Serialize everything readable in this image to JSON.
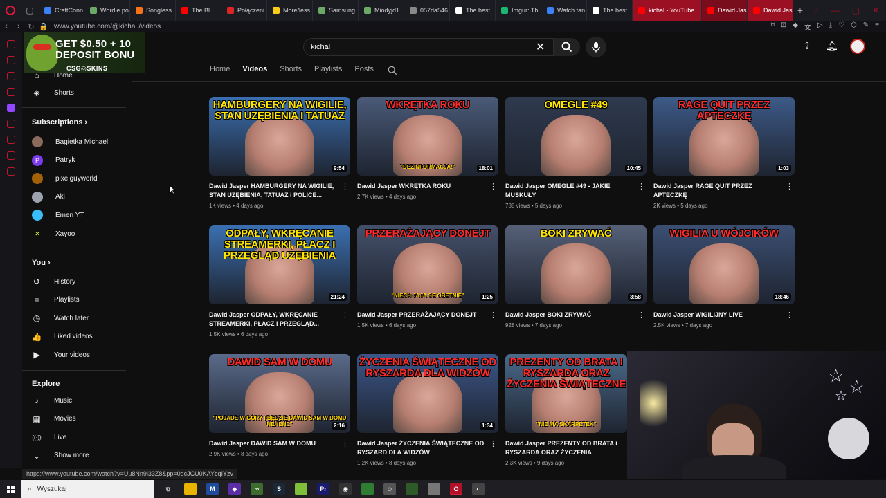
{
  "browser": {
    "tabs": [
      {
        "label": "CraftConn",
        "color": "#3b82f6"
      },
      {
        "label": "Wordle po",
        "color": "#6aaa64"
      },
      {
        "label": "Songless",
        "color": "#f97316"
      },
      {
        "label": "The Bl",
        "color": "#ff0000"
      },
      {
        "label": "Połączeni",
        "color": "#dc2626"
      },
      {
        "label": "More/less",
        "color": "#facc15"
      },
      {
        "label": "Samsung",
        "color": "#6aaa64"
      },
      {
        "label": "Miodyjd1",
        "color": "#6aaa64"
      },
      {
        "label": "057da546",
        "color": "#888888"
      },
      {
        "label": "The best",
        "color": "#ffffff"
      },
      {
        "label": "Imgur: Th",
        "color": "#1bb76e"
      },
      {
        "label": "Watch tan",
        "color": "#3b82f6"
      },
      {
        "label": "The best",
        "color": "#ffffff"
      },
      {
        "label": "kichal - YouTube",
        "color": "#ff0000"
      },
      {
        "label": "Dawid Jas",
        "color": "#ff0000"
      },
      {
        "label": "Dawid Jas",
        "color": "#ff0000"
      }
    ],
    "url": "www.youtube.com/@kichal./videos",
    "status_url": "https://www.youtube.com/watch?v=Uu8Nn9i33Z8&pp=0gcJCU0KAYcqIYzv",
    "accent": "#e31b3b"
  },
  "ad": {
    "line1": "GET $0.50 + 10",
    "line2": "DEPOSIT BONU",
    "brand": "CSG◎SKINS"
  },
  "sidebar": {
    "top_items": [
      {
        "label": "Home",
        "icon": "home-icon",
        "glyph": "⌂"
      },
      {
        "label": "Shorts",
        "icon": "shorts-icon",
        "glyph": "◈"
      }
    ],
    "subscriptions_title": "Subscriptions",
    "subscriptions": [
      {
        "label": "Bagietka Michael",
        "color": "#8a6a5a",
        "glyph": ""
      },
      {
        "label": "Patryk",
        "color": "#7c3aed",
        "glyph": "P"
      },
      {
        "label": "pixelguyworld",
        "color": "#a16207",
        "glyph": ""
      },
      {
        "label": "Aki",
        "color": "#9ca3af",
        "glyph": ""
      },
      {
        "label": "Emen YT",
        "color": "#38bdf8",
        "glyph": ""
      },
      {
        "label": "Xayoo",
        "color": "#0f0f0f",
        "glyph": "✕"
      }
    ],
    "you_title": "You",
    "you_items": [
      {
        "label": "History",
        "icon": "history-icon",
        "glyph": "↺"
      },
      {
        "label": "Playlists",
        "icon": "playlists-icon",
        "glyph": "≡"
      },
      {
        "label": "Watch later",
        "icon": "watch-later-icon",
        "glyph": "◷"
      },
      {
        "label": "Liked videos",
        "icon": "like-icon",
        "glyph": "👍"
      },
      {
        "label": "Your videos",
        "icon": "your-videos-icon",
        "glyph": "▶"
      }
    ],
    "explore_title": "Explore",
    "explore_items": [
      {
        "label": "Music",
        "icon": "music-icon",
        "glyph": "♪"
      },
      {
        "label": "Movies",
        "icon": "movies-icon",
        "glyph": "▦"
      },
      {
        "label": "Live",
        "icon": "live-icon",
        "glyph": "((·))"
      },
      {
        "label": "Show more",
        "icon": "chevron-down-icon",
        "glyph": "⌄"
      }
    ]
  },
  "header": {
    "search_value": "kichal"
  },
  "channel_tabs": [
    "Home",
    "Videos",
    "Shorts",
    "Playlists",
    "Posts"
  ],
  "videos": [
    {
      "caption": "HAMBURGERY NA WIGILIE, STAN UZĘBIENIA I TATUAŻ",
      "cap_color": "#ffe600",
      "bg": "#3b6fb0",
      "sub": "",
      "duration": "9:54",
      "title": "Dawid Jasper HAMBURGERY NA WIGILIE, STAN UZĘBIENIA, TATUAŻ i POLICE...",
      "views": "1K views",
      "age": "4 days ago"
    },
    {
      "caption": "WKRĘTKA ROKU",
      "cap_color": "#ff2a2a",
      "bg": "#4a5a78",
      "sub": "\"DEZINFORMACJA!\"",
      "duration": "18:01",
      "title": "Dawid Jasper WKRĘTKA ROKU",
      "views": "2.7K views",
      "age": "4 days ago"
    },
    {
      "caption": "OMEGLE #49",
      "cap_color": "#ffe600",
      "bg": "#2f3a4e",
      "sub": "",
      "duration": "10:45",
      "title": "Dawid Jasper OMEGLE #49 - JAKIE MUSKUŁY",
      "views": "788 views",
      "age": "5 days ago"
    },
    {
      "caption": "RAGE QUIT PRZEZ APTECZKĘ",
      "cap_color": "#ff2a2a",
      "bg": "#3d5a88",
      "sub": "",
      "duration": "1:03",
      "title": "Dawid Jasper RAGE QUIT PRZEZ APTECZKĘ",
      "views": "2K views",
      "age": "5 days ago"
    },
    {
      "caption": "ODPAŁY, WKRĘCANIE STREAMERKI, PŁACZ I PRZEGLĄD UZĘBIENIA",
      "cap_color": "#ffe600",
      "bg": "#3b6fb0",
      "sub": "",
      "duration": "21:24",
      "title": "Dawid Jasper ODPAŁY, WKRĘCANIE STREAMERKI, PŁACZ i PRZEGLĄD...",
      "views": "1.5K views",
      "age": "6 days ago"
    },
    {
      "caption": "PRZERAŻAJĄCY DONEJT",
      "cap_color": "#ff2a2a",
      "bg": "#44506a",
      "sub": "\"NIECH JAJA SE OBETNIE\"",
      "duration": "1:25",
      "title": "Dawid Jasper PRZERAŻAJĄCY DONEJT",
      "views": "1.5K views",
      "age": "6 days ago"
    },
    {
      "caption": "BOKI ZRYWAĆ",
      "cap_color": "#ffe600",
      "bg": "#556078",
      "sub": "",
      "duration": "3:58",
      "title": "Dawid Jasper BOKI ZRYWAĆ",
      "views": "928 views",
      "age": "7 days ago"
    },
    {
      "caption": "WIGILIA U WÓJCIKÓW",
      "cap_color": "#ff2a2a",
      "bg": "#3b4f72",
      "sub": "",
      "duration": "18:46",
      "title": "Dawid Jasper WIGILIJNY LIVE",
      "views": "2.5K views",
      "age": "7 days ago"
    },
    {
      "caption": "DAWID SAM W DOMU",
      "cap_color": "#ff2a2a",
      "bg": "#5a6a8a",
      "sub": "\"POJADĘ W GÓRY I BĘDZIE DAWID SAM W DOMU HEHEHE\"",
      "duration": "2:16",
      "title": "Dawid Jasper DAWID SAM W DOMU",
      "views": "2.9K views",
      "age": "8 days ago"
    },
    {
      "caption": "ŻYCZENIA ŚWIĄTECZNE OD RYSZARDA DLA WIDZÓW",
      "cap_color": "#ff2a2a",
      "bg": "#3b5688",
      "sub": "",
      "duration": "1:34",
      "title": "Dawid Jasper ŻYCZENIA ŚWIĄTECZNE OD RYSZARD DLA WIDZÓW",
      "views": "1.2K views",
      "age": "8 days ago"
    },
    {
      "caption": "PREZENTY OD BRATA I RYSZARDA ORAZ ŻYCZENIA ŚWIĄTECZNE",
      "cap_color": "#ff2a2a",
      "bg": "#4a6a8a",
      "sub": "\"NIE MA SKARPETEK\"",
      "duration": "",
      "title": "Dawid Jasper PREZENTY OD BRATA i RYSZARDA ORAZ ŻYCZENIA ŚWIĄTECZNE",
      "views": "2.3K views",
      "age": "9 days ago"
    }
  ],
  "taskbar": {
    "search_placeholder": "Wyszukaj"
  }
}
